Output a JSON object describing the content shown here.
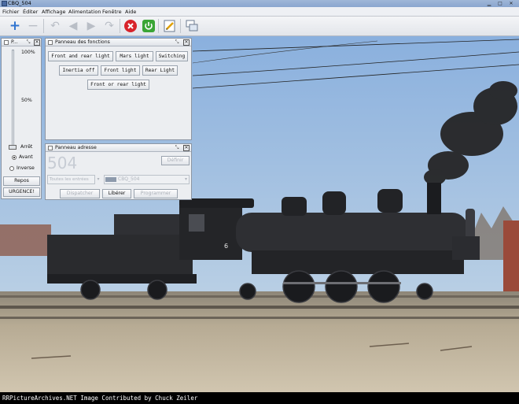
{
  "window": {
    "title": "CBQ_504"
  },
  "menu": [
    "Fichier",
    "Éditer",
    "Affichage",
    "Alimentation",
    "Fenêtre",
    "Aide"
  ],
  "slider_panel": {
    "title": "P...",
    "marks": {
      "top": "100%",
      "mid": "50%"
    },
    "stop_label": "Arrêt",
    "forward_label": "Avant",
    "reverse_label": "Inverse",
    "idle_button": "Repos",
    "emergency_button": "URGENCE!",
    "speed_level_percent": 0,
    "direction": "Avant"
  },
  "functions_panel": {
    "title": "Panneau des fonctions",
    "buttons": [
      "Front and rear light",
      "Mars light",
      "Switching",
      "Inertia off",
      "Front light",
      "Rear Light",
      "Front or rear light"
    ]
  },
  "address_panel": {
    "title": "Panneau adresse",
    "address_value": "504",
    "define_button": "Définir",
    "roster_placeholder": "Toutes les entrées",
    "roster_selected": "CBQ_504",
    "dispatch_button": "Dispatcher",
    "release_button": "Libérer",
    "program_button": "Programmer"
  },
  "credit": "RRPictureArchives.NET Image Contributed by Chuck Zeiler",
  "locomotive_number": "6",
  "colors": {
    "sky": "#9dbbe0",
    "accent": "#3a6bb6"
  }
}
